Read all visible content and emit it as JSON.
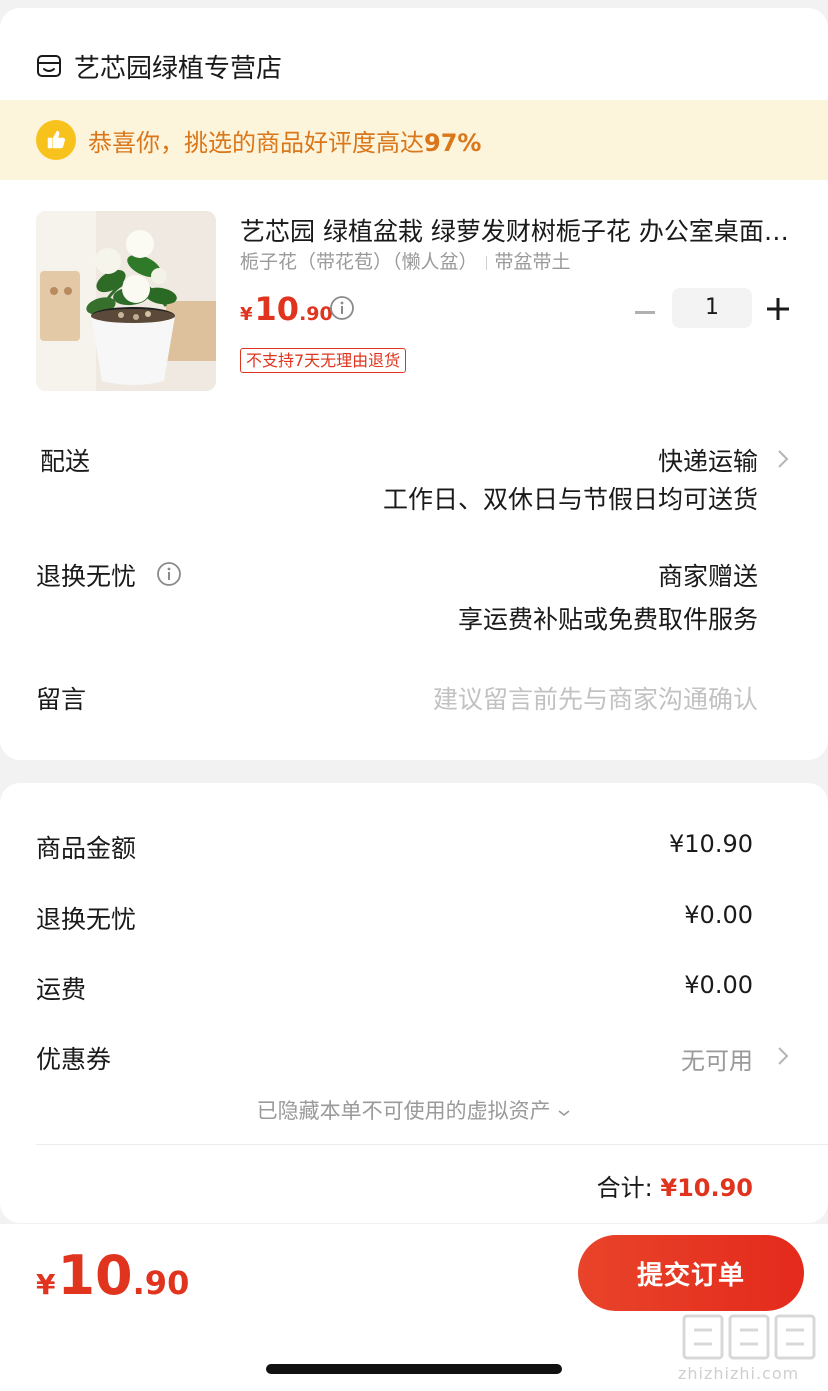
{
  "shop": {
    "icon": "shop-icon",
    "name": "艺芯园绿植专营店"
  },
  "praise": {
    "icon": "thumbs-up-icon",
    "text_prefix": "恭喜你，挑选的商品好评度高达",
    "rate": "97%"
  },
  "product": {
    "title": "艺芯园 绿植盆栽   绿萝发财树栀子花 办公室桌面…",
    "spec_main": "栀子花（带花苞）（懒人盆）",
    "spec_extra": "带盆带土",
    "price_symbol": "¥",
    "price_int": "10",
    "price_dec": ".90",
    "tag": "不支持7天无理由退货",
    "quantity": "1"
  },
  "delivery": {
    "label": "配送",
    "method": "快递运输",
    "note": "工作日、双休日与节假日均可送货"
  },
  "return": {
    "label": "退换无忧",
    "value": "商家赠送",
    "note": "享运费补贴或免费取件服务"
  },
  "message": {
    "label": "留言",
    "placeholder": "建议留言前先与商家沟通确认"
  },
  "summary": {
    "goods_label": "商品金额",
    "goods_value": "¥10.90",
    "return_label": "退换无忧",
    "return_value": "¥0.00",
    "shipping_label": "运费",
    "shipping_value": "¥0.00",
    "coupon_label": "优惠券",
    "coupon_value": "无可用",
    "hidden_note": "已隐藏本单不可使用的虚拟资产",
    "total_label": "合计:",
    "total_value": "¥10.90"
  },
  "footer": {
    "price_symbol": "¥",
    "price_int": "10",
    "price_dec": ".90",
    "submit_label": "提交订单"
  },
  "watermark": {
    "text": "zhizhizhi.com"
  },
  "colors": {
    "accent": "#e0341e",
    "praise_bg": "#fdf4dc",
    "praise_text": "#d9771a"
  }
}
